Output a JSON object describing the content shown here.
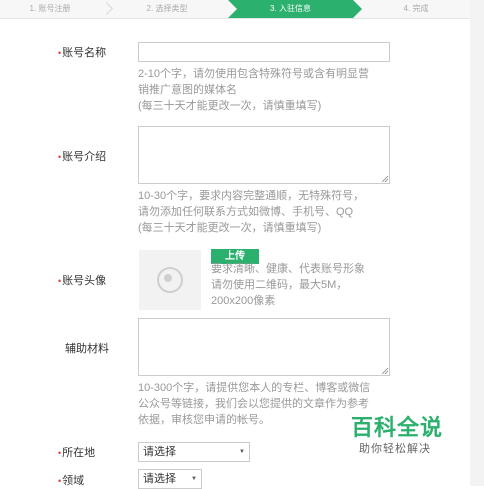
{
  "steps": [
    {
      "label": "1. 账号注册",
      "active": false
    },
    {
      "label": "2. 选择类型",
      "active": false
    },
    {
      "label": "3. 入驻信息",
      "active": true
    },
    {
      "label": "4. 完成",
      "active": false
    }
  ],
  "form": {
    "account_name": {
      "label": "账号名称",
      "help": [
        "2-10个字，请勿使用包含特殊符号或含有明显营",
        "销推广意图的媒体名",
        "(每三十天才能更改一次，请慎重填写)"
      ]
    },
    "account_intro": {
      "label": "账号介绍",
      "help": [
        "10-30个字，要求内容完整通顺，无特殊符号，",
        "请勿添加任何联系方式如微博、手机号、QQ",
        "(每三十天才能更改一次，请慎重填写)"
      ]
    },
    "avatar": {
      "label": "账号头像",
      "upload_label": "上传",
      "help": [
        "要求清晰、健康、代表账号形象",
        "请勿使用二维码，最大5M，",
        "200x200像素"
      ]
    },
    "materials": {
      "label": "辅助材料",
      "help": [
        "10-300个字，请提供您本人的专栏、博客或微信",
        "公众号等链接，我们会以您提供的文章作为参考",
        "依据，审核您申请的帐号。"
      ]
    },
    "location": {
      "label": "所在地",
      "value": "请选择"
    },
    "field": {
      "label": "领域",
      "value": "请选择"
    }
  },
  "watermark": {
    "title": "百科全说",
    "subtitle": "助你轻松解决"
  },
  "colors": {
    "accent": "#2bb06e",
    "required": "#e4393c"
  }
}
